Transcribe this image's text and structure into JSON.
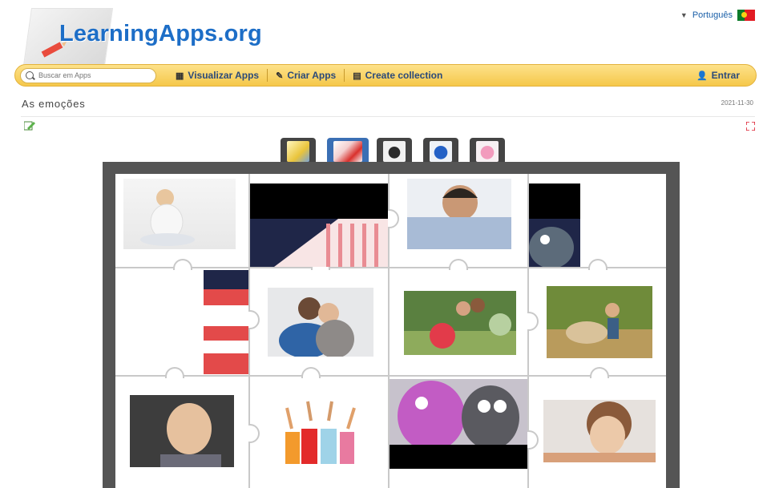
{
  "header": {
    "logo_text": "LearningApps.org",
    "language": "Português"
  },
  "toolbar": {
    "search_placeholder": "Buscar em Apps",
    "view_apps": "Visualizar Apps",
    "create_apps": "Criar Apps",
    "create_collection": "Create collection",
    "login": "Entrar"
  },
  "app": {
    "title": "As emoções",
    "date": "2021-11-30"
  },
  "tabs": [
    {
      "icon": "cartoon-yellow-thumb"
    },
    {
      "icon": "cartoon-red-thumb",
      "active": true
    },
    {
      "icon": "cartoon-dark-thumb"
    },
    {
      "icon": "cartoon-blue-thumb"
    },
    {
      "icon": "cartoon-pink-thumb"
    }
  ],
  "photos": [
    "child-covering-mouth",
    "boy-peeking-blanket",
    "mother-hug",
    "kids-with-balloons",
    "boy-with-dog",
    "crying-baby",
    "cheering-children",
    "pink-and-gray-monsters",
    "pensive-girl"
  ],
  "colors": {
    "toolbar": "#f5c84a",
    "logo": "#1d6ec7",
    "board_frame": "#555555",
    "active_tab": "#3a6fb4"
  }
}
